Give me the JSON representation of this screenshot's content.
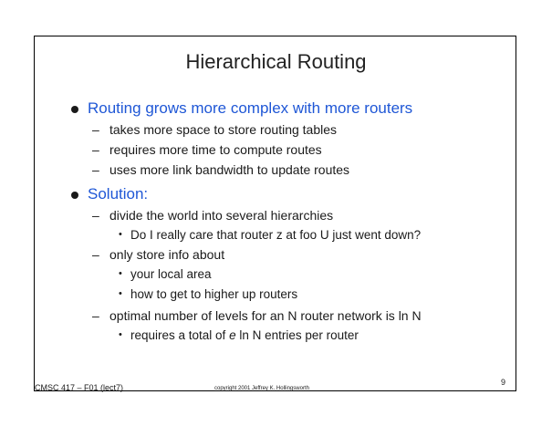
{
  "title": "Hierarchical Routing",
  "bullets": [
    {
      "text": "Routing grows more complex with more routers",
      "subs": [
        "takes more space to store routing tables",
        "requires more time to compute routes",
        "uses more link bandwidth to update routes"
      ]
    },
    {
      "text": "Solution:",
      "subs": [
        "divide the world into several hierarchies",
        "only store info about",
        "optimal number of levels for an N router network is ln N"
      ],
      "subsubs": {
        "hierarchy_question": "Do I really care that router z at foo U just went down?",
        "local_area": "your local area",
        "higher_routers": "how to get to higher up routers",
        "entries_prefix": "requires a total of",
        "entries_var": "e",
        "entries_suffix": "ln N entries per router"
      }
    }
  ],
  "footer": {
    "course": "CMSC 417 – F01  (lect7)",
    "copyright": "copyright 2001 Jeffrey K. Hollingsworth",
    "page": "9"
  },
  "symbols": {
    "dash": "–",
    "sub_bullet": "•"
  },
  "colors": {
    "heading_blue": "#1f57d6",
    "text": "#1a1a1a"
  }
}
